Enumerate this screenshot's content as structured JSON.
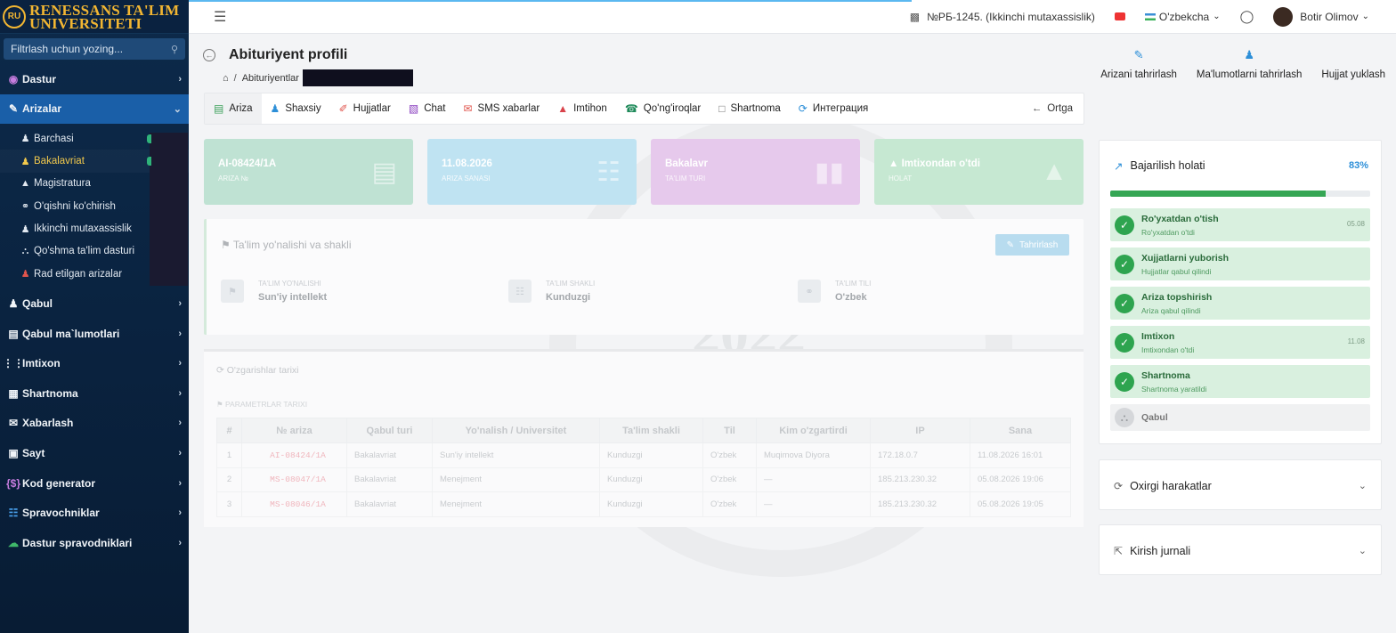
{
  "sidebar": {
    "brand": {
      "line1": "RENESSANS TA'LIM",
      "line2": "UNIVERSITETI"
    },
    "filter_placeholder": "Filtrlash uchun yozing...",
    "items": [
      {
        "label": "Dastur",
        "icon": "dastur-icon"
      },
      {
        "label": "Arizalar",
        "icon": "arizalar-icon"
      },
      {
        "label": "Qabul",
        "icon": "qabul-icon"
      },
      {
        "label": "Qabul ma`lumotlari",
        "icon": "qabul-malumotlari-icon"
      },
      {
        "label": "Imtixon",
        "icon": "grid-icon"
      },
      {
        "label": "Shartnoma",
        "icon": "shartnoma-icon"
      },
      {
        "label": "Xabarlash",
        "icon": "envelope-icon"
      },
      {
        "label": "Sayt",
        "icon": "sayt-icon"
      },
      {
        "label": "Kod generator",
        "icon": "code-icon"
      },
      {
        "label": "Spravochniklar",
        "icon": "database-icon"
      },
      {
        "label": "Dastur spravodniklari",
        "icon": "cloud-icon"
      }
    ],
    "subitems": [
      {
        "label": "Barchasi"
      },
      {
        "label": "Bakalavriat"
      },
      {
        "label": "Magistratura"
      },
      {
        "label": "O'qishni ko'chirish"
      },
      {
        "label": "Ikkinchi mutaxassislik"
      },
      {
        "label": "Qo'shma ta'lim dasturi"
      },
      {
        "label": "Rad etilgan arizalar"
      }
    ]
  },
  "topbar": {
    "org": "№РБ-1245. (Ikkinchi mutaxassislik)",
    "language": "O'zbekcha",
    "user": "Botir Olimov"
  },
  "header": {
    "title": "Abituriyent profili",
    "breadcrumb": "Abituriyentlar",
    "actions": [
      "Arizani tahrirlash",
      "Ma'lumotlarni tahrirlash",
      "Hujjat yuklash"
    ]
  },
  "tabs": [
    "Ariza",
    "Shaxsiy",
    "Hujjatlar",
    "Chat",
    "SMS xabarlar",
    "Imtihon",
    "Qo'ng'iroqlar",
    "Shartnoma",
    "Интеграция"
  ],
  "tab_back": "Ortga",
  "cards": [
    {
      "value": "AI-08424/1A",
      "label": "ARIZA №"
    },
    {
      "value": "11.08.2026",
      "label": "ARIZA SANASI"
    },
    {
      "value": "Bakalavr",
      "label": "TA'LIM TURI"
    },
    {
      "value": "Imtixondan o'tdi",
      "label": "HOLAT"
    }
  ],
  "education": {
    "title": "Ta'lim yo'nalishi va shakli",
    "edit": "Tahrirlash",
    "fields": [
      {
        "label": "TA'LIM YO'NALISHI",
        "value": "Sun'iy intellekt"
      },
      {
        "label": "TA'LIM SHAKLI",
        "value": "Kunduzgi"
      },
      {
        "label": "TA'LIM TILI",
        "value": "O'zbek"
      }
    ]
  },
  "history": {
    "title": "O'zgarishlar tarixi",
    "subtitle": "PARAMETRLAR TARIXI",
    "columns": [
      "#",
      "№ ariza",
      "Qabul turi",
      "Yo'nalish / Universitet",
      "Ta'lim shakli",
      "Til",
      "Kim o'zgartirdi",
      "IP",
      "Sana"
    ],
    "rows": [
      [
        "1",
        "AI-08424/1A",
        "Bakalavriat",
        "Sun'iy intellekt",
        "Kunduzgi",
        "O'zbek",
        "Muqimova Diyora",
        "172.18.0.7",
        "11.08.2026 16:01"
      ],
      [
        "2",
        "MS-08047/1A",
        "Bakalavriat",
        "Menejment",
        "Kunduzgi",
        "O'zbek",
        "—",
        "185.213.230.32",
        "05.08.2026 19:06"
      ],
      [
        "3",
        "MS-08046/1A",
        "Bakalavriat",
        "Menejment",
        "Kunduzgi",
        "O'zbek",
        "—",
        "185.213.230.32",
        "05.08.2026 19:05"
      ]
    ]
  },
  "progress": {
    "title": "Bajarilish holati",
    "percent_text": "83%",
    "percent": 83,
    "steps": [
      {
        "title": "Ro'yxatdan o'tish",
        "sub": "Ro'yxatdan o'tdi",
        "date": "05.08"
      },
      {
        "title": "Xujjatlarni yuborish",
        "sub": "Hujjatlar qabul qilindi",
        "date": ""
      },
      {
        "title": "Ariza topshirish",
        "sub": "Ariza qabul qilindi",
        "date": ""
      },
      {
        "title": "Imtixon",
        "sub": "Imtixondan o'tdi",
        "date": "11.08"
      },
      {
        "title": "Shartnoma",
        "sub": "Shartnoma yaratildi",
        "date": ""
      }
    ],
    "pending": "Qabul"
  },
  "panels": {
    "recent": "Oxirgi harakatlar",
    "log": "Kirish jurnali"
  },
  "watermark_year": "2022"
}
